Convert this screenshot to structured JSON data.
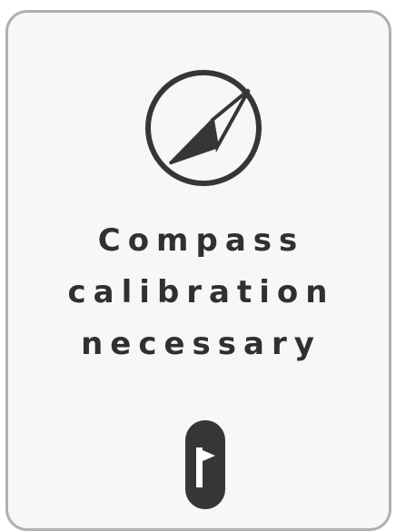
{
  "alert": {
    "icon": "compass-icon",
    "message_lines": [
      "Compass",
      "calibration",
      "necessary"
    ],
    "action_icon": "flag-icon"
  },
  "colors": {
    "text": "#303030",
    "icon": "#363636",
    "card_border": "#b0b0b0",
    "card_background": "#f7f7f7"
  }
}
